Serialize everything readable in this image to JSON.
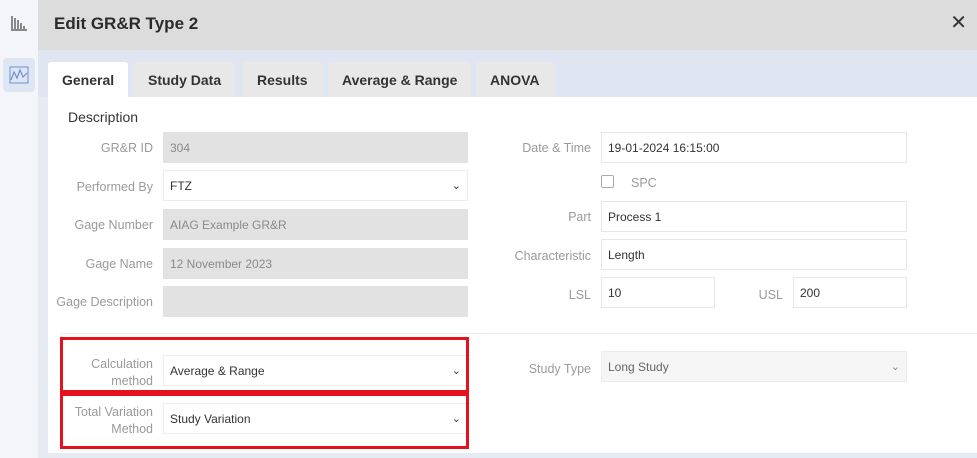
{
  "window": {
    "title": "Edit GR&R Type 2",
    "close_symbol": "✕"
  },
  "rail": {
    "icons": [
      "bar-chart-icon",
      "line-chart-icon"
    ]
  },
  "tabs": [
    {
      "label": "General",
      "active": true
    },
    {
      "label": "Study Data",
      "active": false
    },
    {
      "label": "Results",
      "active": false
    },
    {
      "label": "Average & Range",
      "active": false
    },
    {
      "label": "ANOVA",
      "active": false
    }
  ],
  "form": {
    "section_title": "Description",
    "grr_id": {
      "label": "GR&R ID",
      "value": "304"
    },
    "performed_by": {
      "label": "Performed By",
      "value": "FTZ"
    },
    "gage_number": {
      "label": "Gage Number",
      "value": "AIAG Example GR&R"
    },
    "gage_name": {
      "label": "Gage Name",
      "value": "12 November 2023"
    },
    "gage_description": {
      "label": "Gage Description",
      "value": ""
    },
    "date_time": {
      "label": "Date & Time",
      "value": "19-01-2024 16:15:00"
    },
    "spc": {
      "label": "SPC",
      "checked": false
    },
    "part": {
      "label": "Part",
      "value": "Process 1"
    },
    "characteristic": {
      "label": "Characteristic",
      "value": "Length"
    },
    "lsl": {
      "label": "LSL",
      "value": "10"
    },
    "usl": {
      "label": "USL",
      "value": "200"
    },
    "calculation_method": {
      "label_line1": "Calculation",
      "label_line2": "method",
      "value": "Average & Range"
    },
    "total_variation_method": {
      "label_line1": "Total Variation",
      "label_line2": "Method",
      "value": "Study Variation"
    },
    "study_type": {
      "label": "Study Type",
      "value": "Long Study"
    }
  },
  "colors": {
    "highlight": "#e3121e",
    "header_bg": "#dcdcdc",
    "tab_strip_bg": "#dfe5f1"
  }
}
